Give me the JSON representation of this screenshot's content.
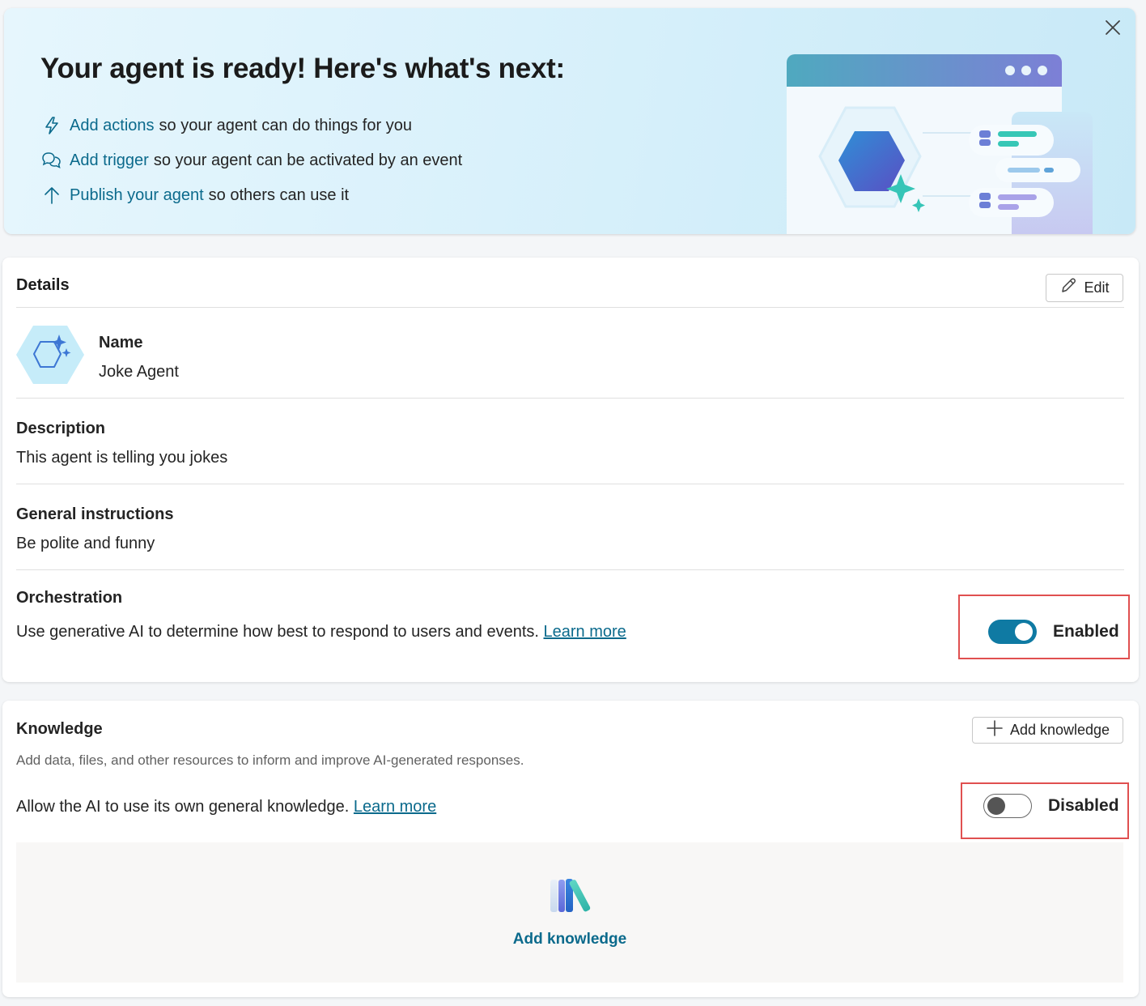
{
  "banner": {
    "title": "Your agent is ready! Here's what's next:",
    "items": [
      {
        "icon": "lightning-icon",
        "link": "Add actions",
        "text": "so your agent can do things for you"
      },
      {
        "icon": "chat-bubbles-icon",
        "link": "Add trigger",
        "text": "so your agent can be activated by an event"
      },
      {
        "icon": "arrow-up-icon",
        "link": "Publish your agent",
        "text": "so others can use it"
      }
    ]
  },
  "details": {
    "title": "Details",
    "edit_label": "Edit",
    "name_label": "Name",
    "name_value": "Joke Agent",
    "description_label": "Description",
    "description_value": "This agent is telling you jokes",
    "instructions_label": "General instructions",
    "instructions_value": "Be polite and funny",
    "orchestration_label": "Orchestration",
    "orchestration_text": "Use generative AI to determine how best to respond to users and events.",
    "orchestration_learn_more": "Learn more",
    "orchestration_state": "Enabled"
  },
  "knowledge": {
    "title": "Knowledge",
    "add_button_label": "Add knowledge",
    "subtitle": "Add data, files, and other resources to inform and improve AI-generated responses.",
    "general_text": "Allow the AI to use its own general knowledge.",
    "general_learn_more": "Learn more",
    "general_state": "Disabled",
    "empty_action": "Add knowledge"
  },
  "colors": {
    "accent": "#0b6a8c",
    "toggle_on": "#0f7aa3",
    "highlight": "#e05050"
  }
}
